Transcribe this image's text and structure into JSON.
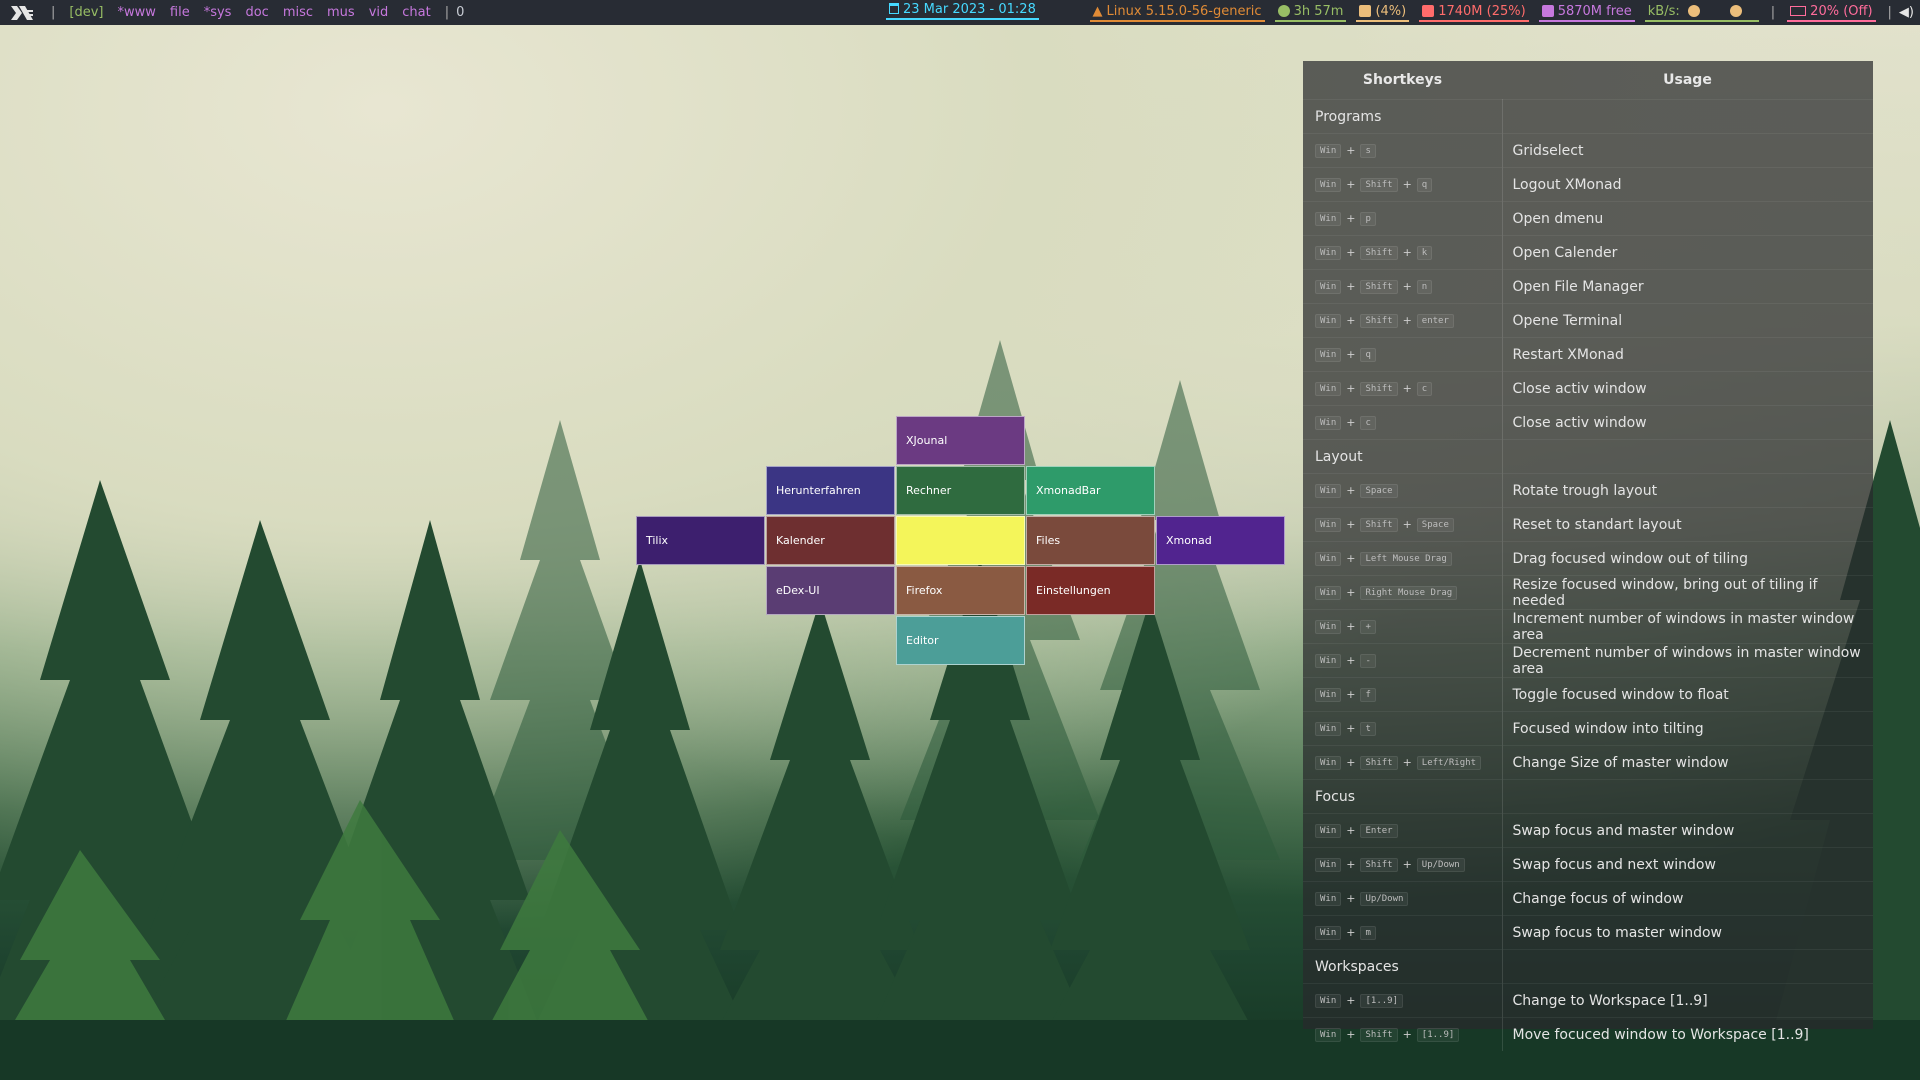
{
  "topbar": {
    "workspaces": [
      {
        "label": "[dev]",
        "color": "#98be65"
      },
      {
        "label": "*www",
        "color": "#c678dd"
      },
      {
        "label": "file",
        "color": "#c678dd"
      },
      {
        "label": "*sys",
        "color": "#c678dd"
      },
      {
        "label": "doc",
        "color": "#c678dd"
      },
      {
        "label": "misc",
        "color": "#c678dd"
      },
      {
        "label": "mus",
        "color": "#c678dd"
      },
      {
        "label": "vid",
        "color": "#c678dd"
      },
      {
        "label": "chat",
        "color": "#c678dd"
      }
    ],
    "window_count": "0",
    "clock": "23 Mar 2023 - 01:28",
    "kernel": "Linux 5.15.0-56-generic",
    "uptime": "3h 57m",
    "cpu": "(4%)",
    "mem": "1740M (25%)",
    "disk": "5870M free",
    "net": "kB/s:",
    "battery": "20% (Off)",
    "colors": {
      "kernel": "#e08b36",
      "uptime": "#98be65",
      "cpu": "#ecbe7b",
      "mem": "#ff6c6b",
      "disk": "#c678dd",
      "net": "#98be65",
      "battery": "#ff6c9b"
    }
  },
  "shortkeys": {
    "header_keys": "Shortkeys",
    "header_usage": "Usage",
    "sections": [
      {
        "title": "Programs",
        "rows": [
          {
            "keys": [
              "Win",
              "s"
            ],
            "usage": "Gridselect"
          },
          {
            "keys": [
              "Win",
              "Shift",
              "q"
            ],
            "usage": "Logout XMonad"
          },
          {
            "keys": [
              "Win",
              "p"
            ],
            "usage": "Open dmenu"
          },
          {
            "keys": [
              "Win",
              "Shift",
              "k"
            ],
            "usage": "Open Calender"
          },
          {
            "keys": [
              "Win",
              "Shift",
              "n"
            ],
            "usage": "Open File Manager"
          },
          {
            "keys": [
              "Win",
              "Shift",
              "enter"
            ],
            "usage": "Opene Terminal"
          },
          {
            "keys": [
              "Win",
              "q"
            ],
            "usage": "Restart XMonad"
          },
          {
            "keys": [
              "Win",
              "Shift",
              "c"
            ],
            "usage": "Close activ window"
          },
          {
            "keys": [
              "Win",
              "c"
            ],
            "usage": "Close activ window"
          }
        ]
      },
      {
        "title": "Layout",
        "rows": [
          {
            "keys": [
              "Win",
              "Space"
            ],
            "usage": "Rotate trough layout"
          },
          {
            "keys": [
              "Win",
              "Shift",
              "Space"
            ],
            "usage": "Reset to standart layout"
          },
          {
            "keys": [
              "Win",
              "Left Mouse Drag"
            ],
            "usage": "Drag focused window out of tiling"
          },
          {
            "keys": [
              "Win",
              "Right Mouse Drag"
            ],
            "usage": "Resize focused window, bring out of tiling if needed"
          },
          {
            "keys": [
              "Win",
              "+"
            ],
            "usage": "Increment number of windows in master window area"
          },
          {
            "keys": [
              "Win",
              "-"
            ],
            "usage": "Decrement number of windows in master window area"
          },
          {
            "keys": [
              "Win",
              "f"
            ],
            "usage": "Toggle focused window to float"
          },
          {
            "keys": [
              "Win",
              "t"
            ],
            "usage": "Focused window into tilting"
          },
          {
            "keys": [
              "Win",
              "Shift",
              "Left/Right"
            ],
            "usage": "Change Size of master window"
          }
        ]
      },
      {
        "title": "Focus",
        "rows": [
          {
            "keys": [
              "Win",
              "Enter"
            ],
            "usage": "Swap focus and master window"
          },
          {
            "keys": [
              "Win",
              "Shift",
              "Up/Down"
            ],
            "usage": "Swap focus and next window"
          },
          {
            "keys": [
              "Win",
              "Up/Down"
            ],
            "usage": "Change focus of window"
          },
          {
            "keys": [
              "Win",
              "m"
            ],
            "usage": "Swap focus to master window"
          }
        ]
      },
      {
        "title": "Workspaces",
        "rows": [
          {
            "keys": [
              "Win",
              "[1..9]"
            ],
            "usage": "Change to Workspace [1..9]"
          },
          {
            "keys": [
              "Win",
              "Shift",
              "[1..9]"
            ],
            "usage": "Move focuced window to Workspace [1..9]"
          }
        ]
      }
    ]
  },
  "gridselect": {
    "items": [
      {
        "label": "XJounal",
        "color": "#6b3a82"
      },
      {
        "label": "Herunterfahren",
        "color": "#3b3584"
      },
      {
        "label": "Rechner",
        "color": "#2f6b3f"
      },
      {
        "label": "XmonadBar",
        "color": "#2e9b6a"
      },
      {
        "label": "Tilix",
        "color": "#3d1f6e"
      },
      {
        "label": "Kalender",
        "color": "#6e2f30"
      },
      {
        "label": "",
        "color": "#f4f55a"
      },
      {
        "label": "Files",
        "color": "#7a4a3c"
      },
      {
        "label": "Xmonad",
        "color": "#51248f"
      },
      {
        "label": "eDex-UI",
        "color": "#5a3d73"
      },
      {
        "label": "Firefox",
        "color": "#8a5a42"
      },
      {
        "label": "Einstellungen",
        "color": "#7a2a26"
      },
      {
        "label": "Editor",
        "color": "#4c9e98"
      }
    ]
  }
}
